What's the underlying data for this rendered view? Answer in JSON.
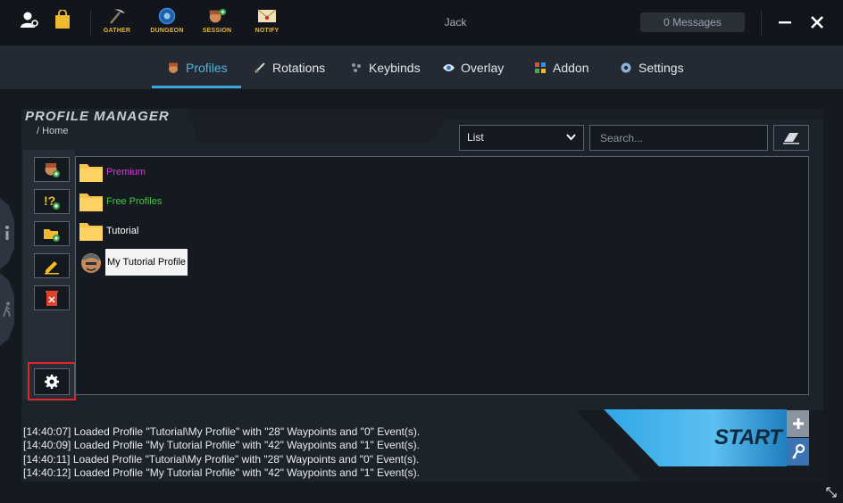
{
  "titlebar": {
    "username": "Jack",
    "messages_label": "0 Messages",
    "tools": [
      {
        "label": "GATHER",
        "icon": "pickaxe-icon"
      },
      {
        "label": "DUNGEON",
        "icon": "gear-badge-icon"
      },
      {
        "label": "SESSION",
        "icon": "character-add-icon"
      },
      {
        "label": "NOTIFY",
        "icon": "envelope-icon"
      }
    ]
  },
  "navbar": {
    "tabs": [
      {
        "label": "Profiles",
        "icon": "profile-icon",
        "active": true
      },
      {
        "label": "Rotations",
        "icon": "sword-icon"
      },
      {
        "label": "Keybinds",
        "icon": "keybinds-icon"
      },
      {
        "label": "Overlay",
        "icon": "eye-icon"
      },
      {
        "label": "Addon",
        "icon": "addon-blocks-icon"
      },
      {
        "label": "Settings",
        "icon": "gear-icon"
      }
    ]
  },
  "profile_manager": {
    "title": "PROFILE MANAGER",
    "breadcrumb": "/  Home",
    "view_select": "List",
    "search_placeholder": "Search...",
    "items": [
      {
        "label": "Premium",
        "type": "folder",
        "color": "#d63ad6"
      },
      {
        "label": "Free Profiles",
        "type": "folder",
        "color": "#46c44b"
      },
      {
        "label": "Tutorial",
        "type": "folder",
        "color": "#ffffff"
      },
      {
        "label": "My Tutorial Profile",
        "type": "profile",
        "color": "#000000"
      }
    ]
  },
  "log": [
    "[14:40:07] Loaded Profile \"Tutorial\\My Profile\" with \"28\" Waypoints and \"0\" Event(s).",
    "[14:40:09] Loaded Profile \"My Tutorial Profile\" with \"42\" Waypoints and \"1\" Event(s).",
    "[14:40:11] Loaded Profile \"Tutorial\\My Profile\" with \"28\" Waypoints and \"0\" Event(s).",
    "[14:40:12] Loaded Profile \"My Tutorial Profile\" with \"42\" Waypoints and \"1\" Event(s)."
  ],
  "start_label": "START",
  "colors": {
    "accent": "#3aa6de",
    "tool_label": "#e8b73a",
    "highlight_outline": "#e0262a"
  }
}
